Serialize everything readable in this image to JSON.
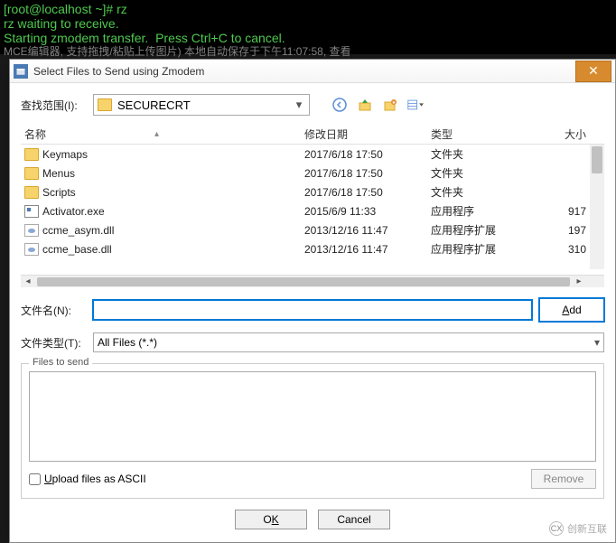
{
  "terminal": {
    "line1": "[root@localhost ~]# rz",
    "line2": "rz waiting to receive.",
    "line3": "Starting zmodem transfer.  Press Ctrl+C to cancel.",
    "dimline": "MCE编辑器, 支持拖拽/粘贴上传图片)   本地自动保存于下午11:07:58,  查看"
  },
  "dialog": {
    "title": "Select Files to Send using Zmodem",
    "lookin_label": "查找范围(I):",
    "lookin_value": "SECURECRT",
    "columns": {
      "name": "名称",
      "date": "修改日期",
      "type": "类型",
      "size": "大小"
    },
    "rows": [
      {
        "icon": "folder",
        "name": "Keymaps",
        "date": "2017/6/18 17:50",
        "type": "文件夹",
        "size": ""
      },
      {
        "icon": "folder",
        "name": "Menus",
        "date": "2017/6/18 17:50",
        "type": "文件夹",
        "size": ""
      },
      {
        "icon": "folder",
        "name": "Scripts",
        "date": "2017/6/18 17:50",
        "type": "文件夹",
        "size": ""
      },
      {
        "icon": "exe",
        "name": "Activator.exe",
        "date": "2015/6/9 11:33",
        "type": "应用程序",
        "size": "917"
      },
      {
        "icon": "dll",
        "name": "ccme_asym.dll",
        "date": "2013/12/16 11:47",
        "type": "应用程序扩展",
        "size": "197"
      },
      {
        "icon": "dll",
        "name": "ccme_base.dll",
        "date": "2013/12/16 11:47",
        "type": "应用程序扩展",
        "size": "310"
      }
    ],
    "filename_label": "文件名(N):",
    "filename_value": "",
    "filetype_label": "文件类型(T):",
    "filetype_value": "All Files (*.*)",
    "add_label": "Add",
    "group_label": "Files to send",
    "upload_ascii_label": "Upload files as ASCII",
    "remove_label": "Remove",
    "ok_label": "OK",
    "cancel_label": "Cancel"
  },
  "watermark": {
    "text": "创新互联"
  }
}
